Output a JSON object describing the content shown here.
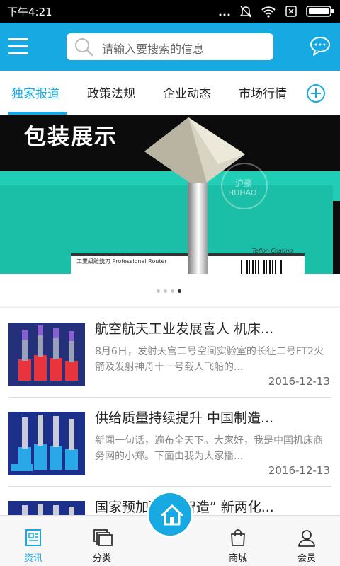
{
  "status_bar": {
    "time": "下午4:21"
  },
  "header": {
    "search_placeholder": "请输入要搜索的信息"
  },
  "tabs": [
    {
      "label": "独家报道",
      "active": true
    },
    {
      "label": "政策法规",
      "active": false
    },
    {
      "label": "企业动态",
      "active": false
    },
    {
      "label": "市场行情",
      "active": false
    }
  ],
  "banner": {
    "title": "包装展示",
    "label_text": "工業級雕銑刀 Professional Router",
    "coating_text": "Teflon Coating",
    "watermark_top": "沪豪",
    "watermark_bottom": "HUHAO",
    "page_count": 4,
    "current_page": 4
  },
  "news": [
    {
      "title": "航空航天工业发展喜人 机床...",
      "summary": "8月6日，发射天宫二号空间实验室的长征二号FT2火箭及发射神舟十一号载人飞船的...",
      "date": "2016-12-13"
    },
    {
      "title": "供给质量持续提升 中国制造...",
      "summary": "新闻一句话，遍布全天下。大家好，我是中国机床商务网的小郑。下面由我为大家播...",
      "date": "2016-12-13"
    },
    {
      "title": "国家预加码助“智造” 新两化...",
      "summary": "",
      "date": ""
    }
  ],
  "bottom_nav": {
    "items": [
      {
        "label": "资讯",
        "icon": "news-icon",
        "active": true
      },
      {
        "label": "分类",
        "icon": "category-icon",
        "active": false
      },
      {
        "label": "商城",
        "icon": "shop-bag-icon",
        "active": false
      },
      {
        "label": "会员",
        "icon": "user-icon",
        "active": false
      }
    ],
    "home_icon": "home-icon"
  },
  "colors": {
    "accent": "#17a9e1",
    "status_bar": "#000000",
    "banner_box": "#1bbfa7"
  }
}
